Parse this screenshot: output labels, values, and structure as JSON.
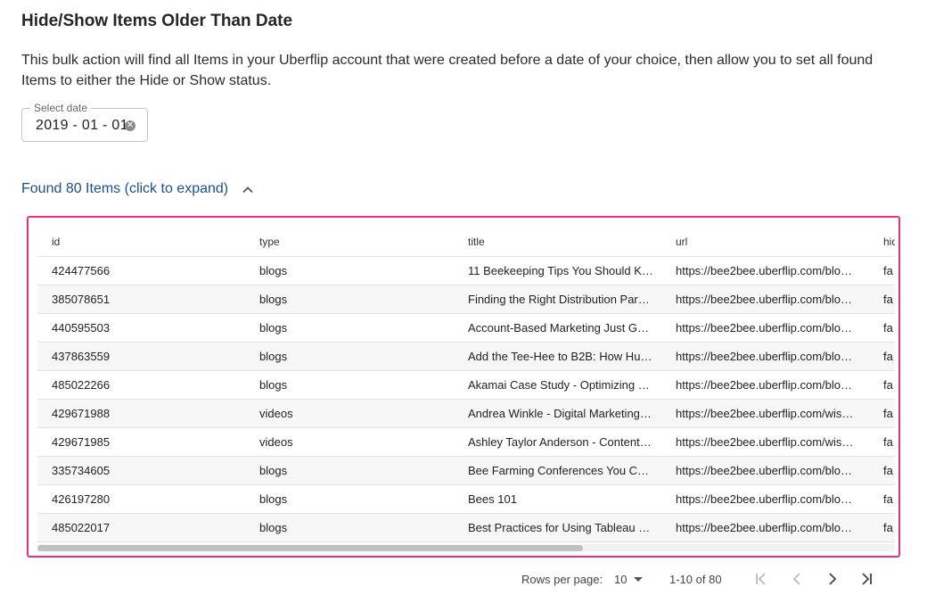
{
  "header": {
    "title": "Hide/Show Items Older Than Date",
    "description": "This bulk action will find all Items in your Uberflip account that were created before a date of your choice, then allow you to set all found Items to either the Hide or Show status."
  },
  "date_picker": {
    "label": "Select date",
    "value": "2019 - 01 - 01",
    "clear_icon": "clear-circle-icon"
  },
  "results": {
    "toggle_label": "Found 80 Items (click to expand)",
    "toggle_icon": "chevron-up-icon"
  },
  "table": {
    "columns": [
      "id",
      "type",
      "title",
      "url",
      "hid"
    ],
    "rows": [
      {
        "id": "424477566",
        "type": "blogs",
        "title": "11 Beekeeping Tips You Should K…",
        "url": "https://bee2bee.uberflip.com/blo…",
        "hidden": "fa"
      },
      {
        "id": "385078651",
        "type": "blogs",
        "title": "Finding the Right Distribution Par…",
        "url": "https://bee2bee.uberflip.com/blo…",
        "hidden": "fa"
      },
      {
        "id": "440595503",
        "type": "blogs",
        "title": "Account-Based Marketing Just G…",
        "url": "https://bee2bee.uberflip.com/blo…",
        "hidden": "fa"
      },
      {
        "id": "437863559",
        "type": "blogs",
        "title": "Add the Tee-Hee to B2B: How Hu…",
        "url": "https://bee2bee.uberflip.com/blo…",
        "hidden": "fa"
      },
      {
        "id": "485022266",
        "type": "blogs",
        "title": "Akamai Case Study - Optimizing …",
        "url": "https://bee2bee.uberflip.com/blo…",
        "hidden": "fa"
      },
      {
        "id": "429671988",
        "type": "videos",
        "title": "Andrea Winkle - Digital Marketing…",
        "url": "https://bee2bee.uberflip.com/wis…",
        "hidden": "fa"
      },
      {
        "id": "429671985",
        "type": "videos",
        "title": "Ashley Taylor Anderson - Content…",
        "url": "https://bee2bee.uberflip.com/wis…",
        "hidden": "fa"
      },
      {
        "id": "335734605",
        "type": "blogs",
        "title": "Bee Farming Conferences You C…",
        "url": "https://bee2bee.uberflip.com/blo…",
        "hidden": "fa"
      },
      {
        "id": "426197280",
        "type": "blogs",
        "title": "Bees 101",
        "url": "https://bee2bee.uberflip.com/blo…",
        "hidden": "fa"
      },
      {
        "id": "485022017",
        "type": "blogs",
        "title": "Best Practices for Using Tableau …",
        "url": "https://bee2bee.uberflip.com/blo…",
        "hidden": "fa"
      }
    ]
  },
  "pagination": {
    "rows_per_page_label": "Rows per page:",
    "rows_per_page": "10",
    "range": "1-10 of 80",
    "icons": [
      "first-page-icon",
      "previous-page-icon",
      "next-page-icon",
      "last-page-icon"
    ]
  },
  "colors": {
    "accent_link": "#1d4f8a",
    "highlight_border": "#e8317a"
  }
}
